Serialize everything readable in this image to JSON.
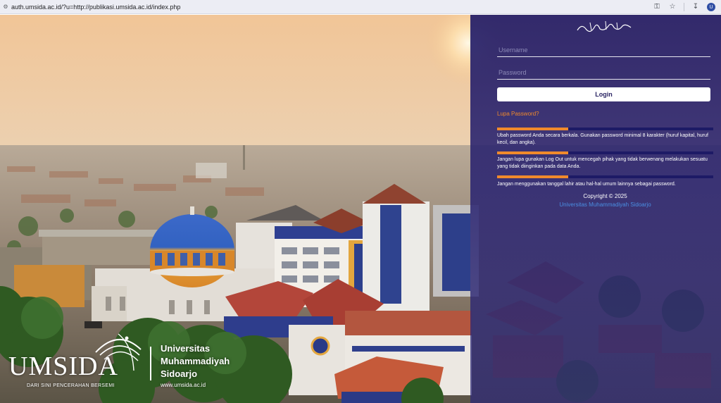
{
  "browser": {
    "url": "auth.umsida.ac.id/?u=http://publikasi.umsida.ac.id/index.php",
    "icons": [
      "site-info-icon",
      "password-key-icon",
      "bookmark-star-icon",
      "download-icon",
      "profile-avatar"
    ],
    "avatar_letter": "U"
  },
  "login": {
    "username_placeholder": "Username",
    "password_placeholder": "Password",
    "login_label": "Login",
    "forgot_label": "Lupa Password?"
  },
  "tips": [
    {
      "text": "Ubah password Anda secara berkala. Gunakan password minimal 8 karakter (huruf kapital, huruf kecil, dan angka)."
    },
    {
      "text": "Jangan lupa gunakan Log Out untuk mencegah pihak yang tidak berwenang melakukan sesuatu yang tidak diinginkan pada data Anda."
    },
    {
      "text": "Jangan menggunakan tanggal lahir atau hal-hal umum lainnya sebagai password."
    }
  ],
  "footer": {
    "copyright": "Copyright © 2025",
    "university_link": "Universitas Muhammadiyah Sidoarjo"
  },
  "logo": {
    "wordmark": "UMSIDA",
    "tagline": "DARI SINI PENCERAHAN BERSEMI",
    "name_line1": "Universitas",
    "name_line2": "Muhammadiyah",
    "name_line3": "Sidoarjo",
    "website": "www.umsida.ac.id"
  },
  "colors": {
    "accent_orange": "#f08a2c",
    "panel_navy": "#241e68",
    "link_blue": "#4a8fe3"
  }
}
